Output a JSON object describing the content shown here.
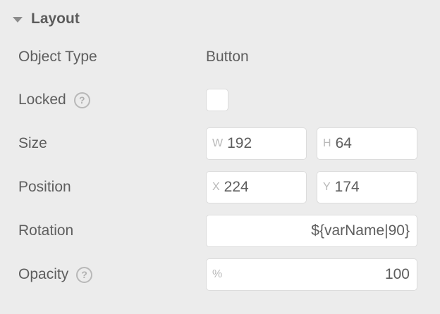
{
  "section": {
    "title": "Layout"
  },
  "rows": {
    "object_type": {
      "label": "Object Type",
      "value": "Button"
    },
    "locked": {
      "label": "Locked",
      "help": "?",
      "checked": false
    },
    "size": {
      "label": "Size",
      "width_prefix": "W",
      "width_value": "192",
      "height_prefix": "H",
      "height_value": "64"
    },
    "position": {
      "label": "Position",
      "x_prefix": "X",
      "x_value": "224",
      "y_prefix": "Y",
      "y_value": "174"
    },
    "rotation": {
      "label": "Rotation",
      "value": "${varName|90}"
    },
    "opacity": {
      "label": "Opacity",
      "help": "?",
      "prefix": "%",
      "value": "100"
    }
  }
}
